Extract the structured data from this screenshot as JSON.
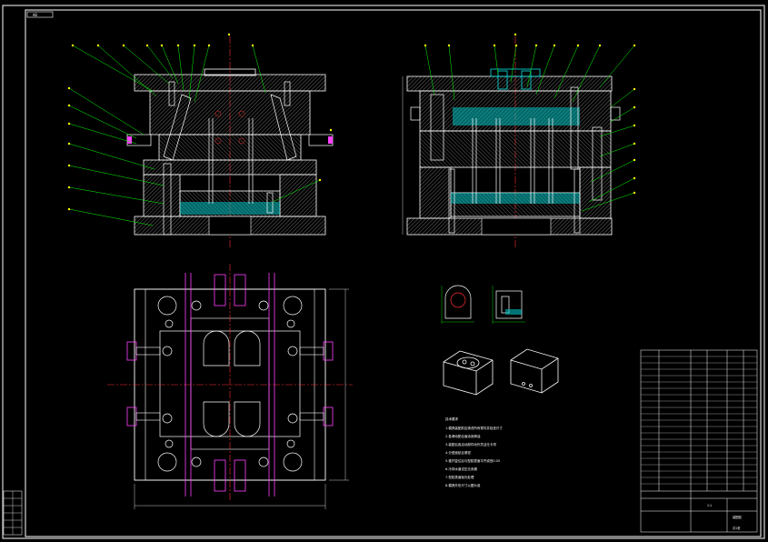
{
  "title_tag": "A0",
  "left_stamp": "",
  "tech_notes_title": "技术要求",
  "tech_notes": [
    "1.模具装配前应清洗所有零件并检查尺寸",
    "2.各滑动配合面涂润滑油",
    "3.装配后各活动部件动作灵活无卡滞",
    "4.分型面贴合紧密",
    "5.推杆复位后与型腔表面平齐或低0.05",
    "6.冷却水道试压无渗漏",
    "7.型腔表面抛光处理",
    "8.模具外形尺寸以图为准"
  ],
  "title_block": {
    "drawing_name": "装配图",
    "scale": "1:1",
    "sheet": "共1张"
  },
  "colors": {
    "background": "#000000",
    "outline": "#ffffff",
    "hatch": "#8a8a8a",
    "leader": "#00ff00",
    "centerline": "#ff3030",
    "magenta": "#ff40ff",
    "cyan": "#00e5e5",
    "yellow": "#ffff00"
  },
  "icons": [
    "front-section-view",
    "side-section-view",
    "plan-view",
    "part-detail-views",
    "isometric-parts"
  ]
}
